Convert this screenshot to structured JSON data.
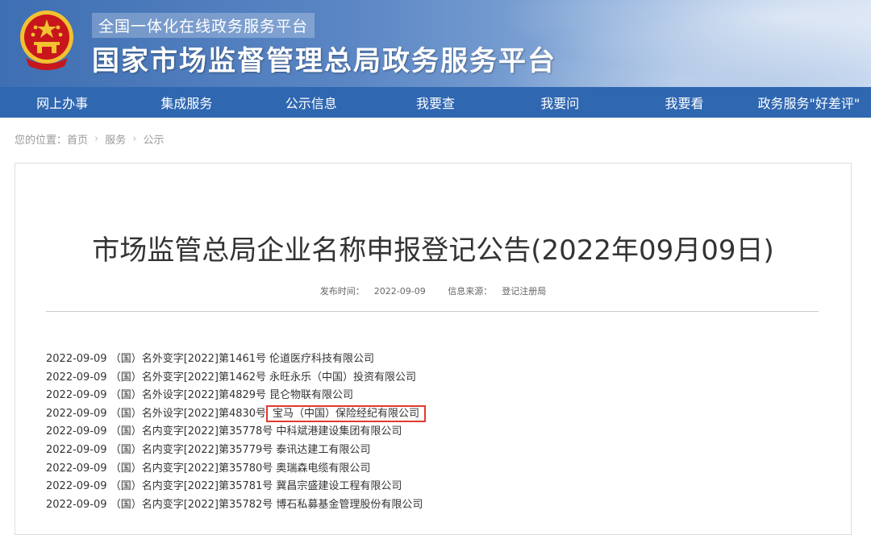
{
  "header": {
    "sub_title": "全国一体化在线政务服务平台",
    "main_title": "国家市场监督管理总局政务服务平台"
  },
  "nav": [
    "网上办事",
    "集成服务",
    "公示信息",
    "我要查",
    "我要问",
    "我要看",
    "政务服务\"好差评\""
  ],
  "breadcrumb": {
    "label": "您的位置：",
    "items": [
      "首页",
      "服务",
      "公示"
    ]
  },
  "article": {
    "title": "市场监管总局企业名称申报登记公告(2022年09月09日)",
    "publish_label": "发布时间：",
    "publish_date": "2022-09-09",
    "source_label": "信息来源：",
    "source": "登记注册局"
  },
  "rows": [
    {
      "date": "2022-09-09",
      "prefix": "（国）",
      "code": "名外变字[2022]第1461号",
      "company": "伦道医疗科技有限公司",
      "highlight": false
    },
    {
      "date": "2022-09-09",
      "prefix": "（国）",
      "code": "名外变字[2022]第1462号",
      "company": "永旺永乐（中国）投资有限公司",
      "highlight": false
    },
    {
      "date": "2022-09-09",
      "prefix": "（国）",
      "code": "名外设字[2022]第4829号",
      "company": "昆仑物联有限公司",
      "highlight": false
    },
    {
      "date": "2022-09-09",
      "prefix": "（国）",
      "code": "名外设字[2022]第4830号",
      "company": "宝马（中国）保险经纪有限公司",
      "highlight": true
    },
    {
      "date": "2022-09-09",
      "prefix": "（国）",
      "code": "名内变字[2022]第35778号",
      "company": "中科斌港建设集团有限公司",
      "highlight": false
    },
    {
      "date": "2022-09-09",
      "prefix": "（国）",
      "code": "名内变字[2022]第35779号",
      "company": "泰讯达建工有限公司",
      "highlight": false
    },
    {
      "date": "2022-09-09",
      "prefix": "（国）",
      "code": "名内变字[2022]第35780号",
      "company": "奥瑞森电缆有限公司",
      "highlight": false
    },
    {
      "date": "2022-09-09",
      "prefix": "（国）",
      "code": "名内变字[2022]第35781号",
      "company": "冀昌宗盛建设工程有限公司",
      "highlight": false
    },
    {
      "date": "2022-09-09",
      "prefix": "（国）",
      "code": "名内变字[2022]第35782号",
      "company": "博石私募基金管理股份有限公司",
      "highlight": false
    }
  ],
  "colors": {
    "nav_bg": "#2f67b1",
    "highlight_border": "#e03a2f",
    "emblem_red": "#c8161d",
    "emblem_gold": "#f2c230"
  }
}
